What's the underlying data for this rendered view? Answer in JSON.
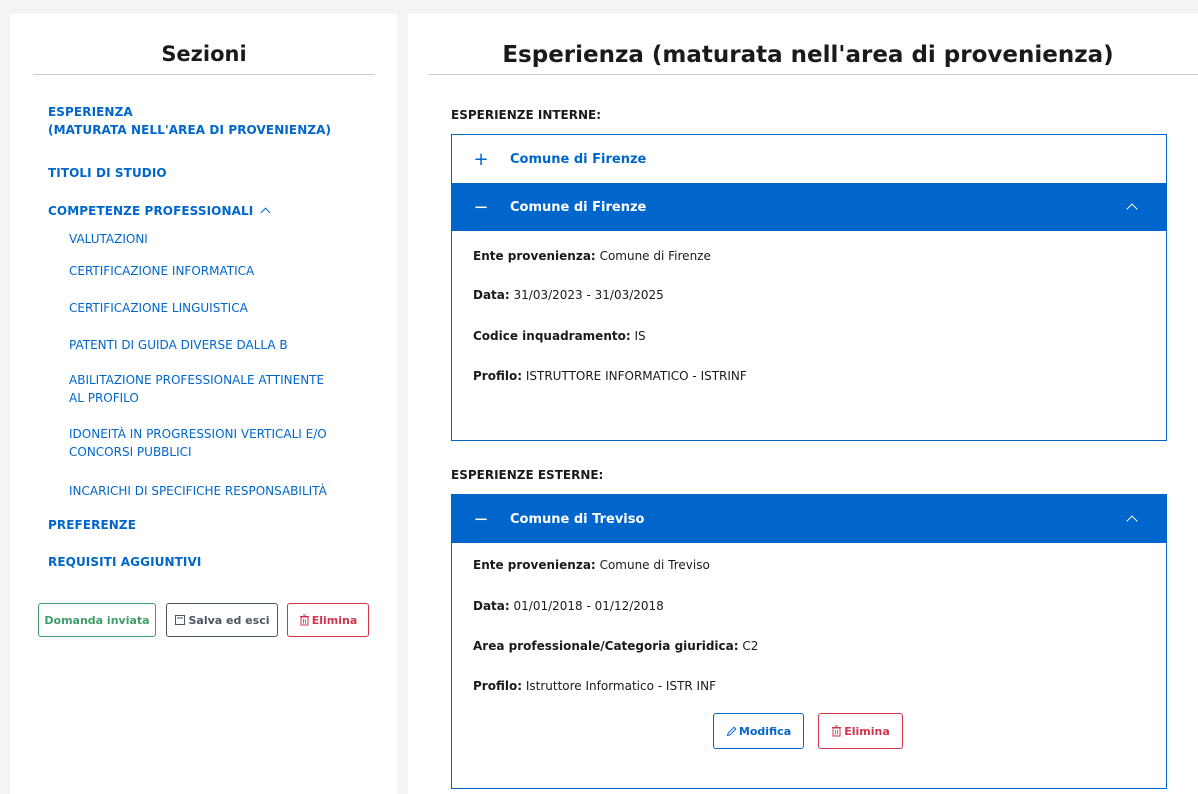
{
  "sidebar": {
    "title": "Sezioni",
    "items": [
      {
        "label_line1": "ESPERIENZA",
        "label_line2": "(MATURATA NELL'AREA DI PROVENIENZA)"
      },
      {
        "label": "TITOLI DI STUDIO"
      },
      {
        "label": "COMPETENZE PROFESSIONALI"
      },
      {
        "label": "PREFERENZE"
      },
      {
        "label": "REQUISITI AGGIUNTIVI"
      }
    ],
    "subitems": [
      {
        "line1": "VALUTAZIONI"
      },
      {
        "line1": "CERTIFICAZIONE INFORMATICA"
      },
      {
        "line1": "CERTIFICAZIONE LINGUISTICA"
      },
      {
        "line1": "PATENTI DI GUIDA DIVERSE DALLA B"
      },
      {
        "line1": "ABILITAZIONE PROFESSIONALE ATTINENTE",
        "line2": "AL PROFILO"
      },
      {
        "line1": "IDONEITÀ IN PROGRESSIONI VERTICALI E/O",
        "line2": "CONCORSI PUBBLICI"
      },
      {
        "line1": "INCARICHI DI SPECIFICHE RESPONSABILITÀ"
      }
    ],
    "buttons": {
      "sent": "Domanda inviata",
      "save": "Salva ed esci",
      "delete": "Elimina"
    }
  },
  "main": {
    "title": "Esperienza (maturata nell'area di provenienza)",
    "internal": {
      "heading": "ESPERIENZE INTERNE:",
      "closed_item": {
        "sign": "+",
        "label": "Comune di Firenze"
      },
      "open_item": {
        "sign": "−",
        "label": "Comune di Firenze",
        "fields": [
          {
            "key": "Ente provenienza:",
            "value": "Comune di Firenze"
          },
          {
            "key": "Data:",
            "value": "31/03/2023 - 31/03/2025"
          },
          {
            "key": "Codice inquadramento:",
            "value": "IS"
          },
          {
            "key": "Profilo:",
            "value": "ISTRUTTORE INFORMATICO - ISTRINF"
          }
        ]
      }
    },
    "external": {
      "heading": "ESPERIENZE ESTERNE:",
      "open_item": {
        "sign": "−",
        "label": "Comune di Treviso",
        "fields": [
          {
            "key": "Ente provenienza:",
            "value": "Comune di Treviso"
          },
          {
            "key": "Data:",
            "value": "01/01/2018 - 01/12/2018"
          },
          {
            "key": "Area professionale/Categoria giuridica:",
            "value": "C2"
          },
          {
            "key": "Profilo:",
            "value": "Istruttore Informatico - ISTR INF"
          }
        ],
        "edit_label": "Modifica",
        "delete_label": "Elimina"
      }
    }
  },
  "colors": {
    "accent": "#0066cc",
    "success": "#3f9c6b",
    "danger": "#d1344b",
    "neutral": "#4b5563"
  }
}
